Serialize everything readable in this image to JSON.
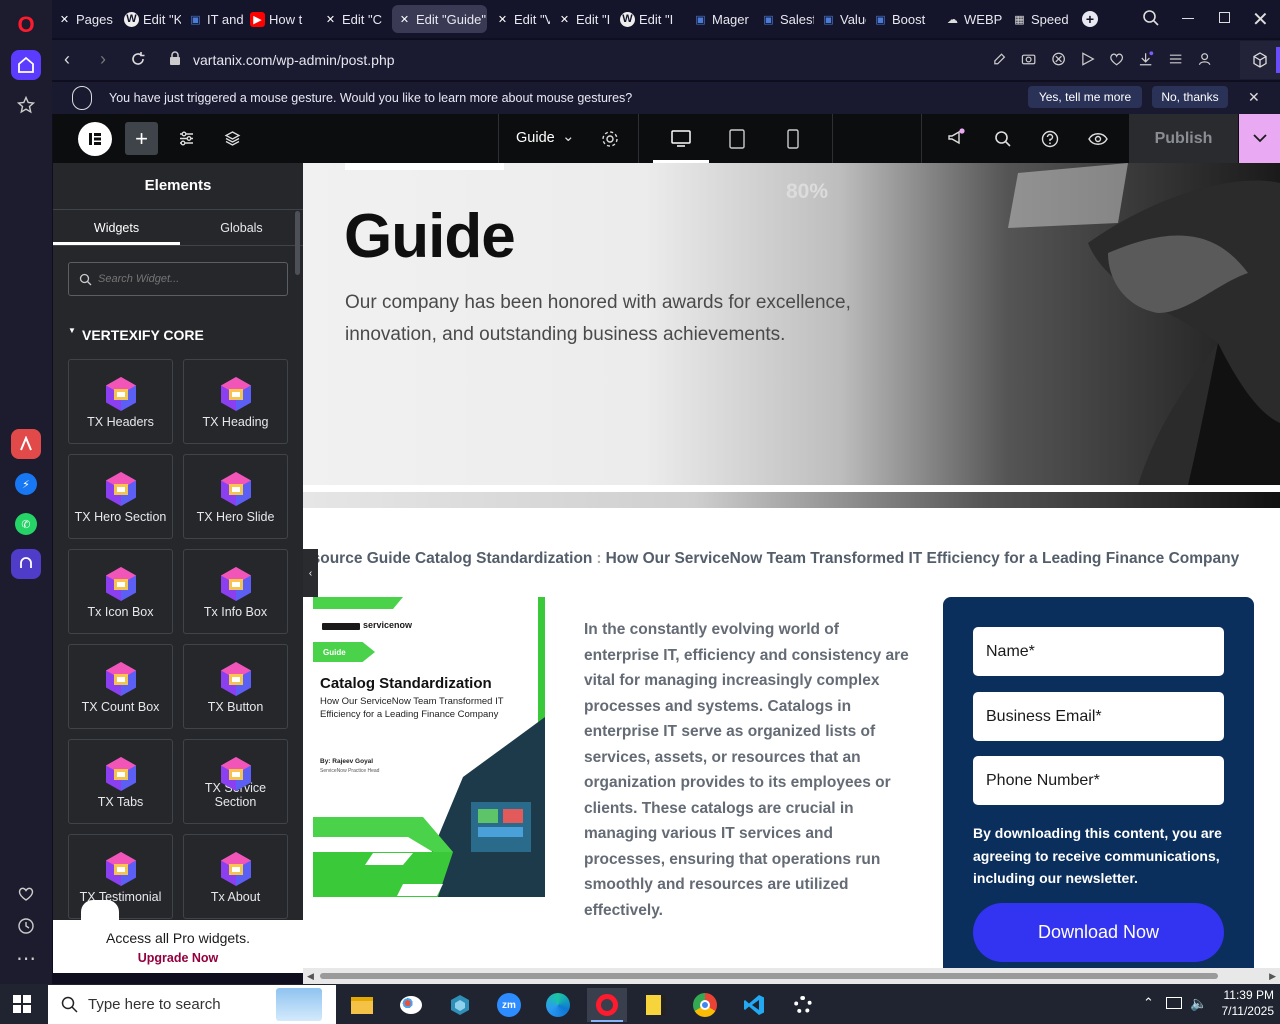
{
  "browser": {
    "tabs": [
      {
        "label": "Pages",
        "icon": "wordpress-x-icon"
      },
      {
        "label": "Edit \"K",
        "icon": "wordpress-icon"
      },
      {
        "label": "IT and",
        "icon": "jira-icon"
      },
      {
        "label": "How t",
        "icon": "youtube-icon"
      },
      {
        "label": "Edit \"C",
        "icon": "wordpress-x-icon"
      },
      {
        "label": "Edit \"Guide\"",
        "icon": "wordpress-x-icon",
        "active": true
      },
      {
        "label": "Edit \"V",
        "icon": "wordpress-x-icon"
      },
      {
        "label": "Edit \"I",
        "icon": "wordpress-x-icon"
      },
      {
        "label": "Edit \"I",
        "icon": "wordpress-icon"
      },
      {
        "label": "Mager",
        "icon": "jira-icon"
      },
      {
        "label": "Salesfo",
        "icon": "jira-icon"
      },
      {
        "label": "Value c",
        "icon": "jira-icon"
      },
      {
        "label": "Boost",
        "icon": "jira-icon"
      },
      {
        "label": "WEBP",
        "icon": "cloud-icon"
      },
      {
        "label": "Speed",
        "icon": "grid-icon"
      }
    ],
    "url": "vartanix.com/wp-admin/post.php",
    "notification": {
      "text": "You have just triggered a mouse gesture. Would you like to learn more about mouse gestures?",
      "yes_label": "Yes, tell me more",
      "no_label": "No, thanks"
    }
  },
  "editor": {
    "page_name": "Guide",
    "publish_label": "Publish",
    "panel_title": "Elements",
    "tab_widgets": "Widgets",
    "tab_globals": "Globals",
    "search_placeholder": "Search Widget...",
    "category": "VERTEXIFY CORE",
    "widgets": [
      "TX Headers",
      "TX Heading",
      "TX Hero Section",
      "TX Hero Slide",
      "Tx Icon Box",
      "Tx Info Box",
      "TX Count Box",
      "TX Button",
      "TX Tabs",
      "TX Service Section",
      "TX Testimonial",
      "Tx About"
    ],
    "promo_text": "Access all Pro widgets.",
    "promo_link": "Upgrade Now"
  },
  "page": {
    "hero_title": "Guide",
    "hero_subtitle_1": "Our company has been honored with awards for excellence,",
    "hero_subtitle_2": "innovation, and outstanding business achievements.",
    "hero_badge": "80%",
    "breadcrumb_a": "esource Guide Catalog Standardization",
    "breadcrumb_sep": ":",
    "breadcrumb_b": "How Our ServiceNow Team Transformed IT Efficiency for a Leading Finance Company",
    "cover": {
      "brand": "servicenow",
      "tag": "Guide",
      "title": "Catalog Standardization",
      "subtitle": "How Our ServiceNow Team Transformed IT Efficiency for a Leading Finance Company",
      "author": "By: Rajeev Goyal",
      "author_role": "ServiceNow Practice Head"
    },
    "body_text": "In the constantly evolving world of enterprise IT, efficiency and consistency are vital for managing increasingly complex processes and systems. Catalogs in enterprise IT serve as organized lists of services, assets, or resources that an organization provides to its employees or clients. These catalogs are crucial in managing various IT services and processes, ensuring that operations run smoothly and resources are utilized effectively.",
    "form": {
      "name_placeholder": "Name*",
      "email_placeholder": "Business Email*",
      "phone_placeholder": "Phone Number*",
      "consent": "By downloading this content, you are agreeing to receive communications, including our newsletter.",
      "button": "Download Now"
    }
  },
  "taskbar": {
    "search_placeholder": "Type here to search",
    "time": "11:39 PM",
    "date": "7/11/2025"
  },
  "colors": {
    "accent": "#9b5cf6",
    "publish_pink": "#e9a9f3",
    "download_blue": "#3333f2",
    "form_navy": "#0b2f5c"
  }
}
